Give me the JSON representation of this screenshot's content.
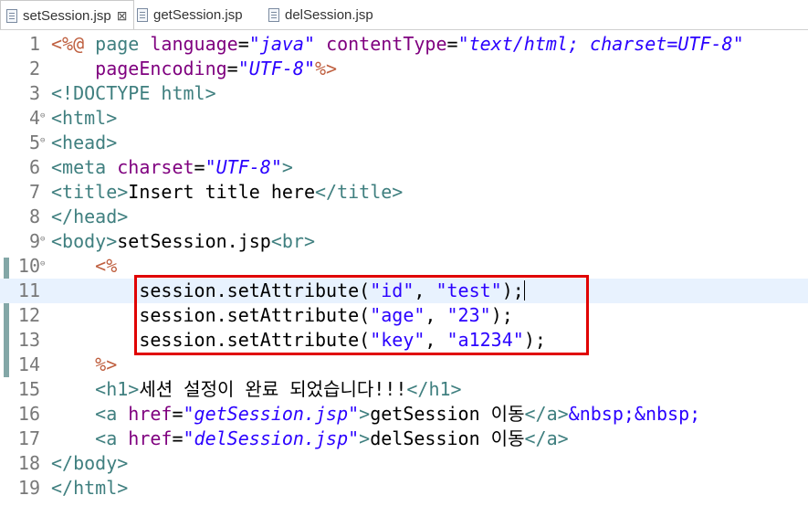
{
  "tabs": [
    {
      "label": "setSession.jsp",
      "close": "⊠",
      "active": true
    },
    {
      "label": "getSession.jsp",
      "active": false
    },
    {
      "label": "delSession.jsp",
      "active": false
    }
  ],
  "lines": [
    {
      "n": "1",
      "tokens": [
        {
          "t": "<%@ ",
          "c": "jsp"
        },
        {
          "t": "page",
          "c": "tag"
        },
        {
          "t": " ",
          "c": "txt"
        },
        {
          "t": "language",
          "c": "attr"
        },
        {
          "t": "=",
          "c": "txt"
        },
        {
          "t": "\"java\"",
          "c": "val"
        },
        {
          "t": " ",
          "c": "txt"
        },
        {
          "t": "contentType",
          "c": "attr"
        },
        {
          "t": "=",
          "c": "txt"
        },
        {
          "t": "\"text/html; charset=UTF-8\"",
          "c": "val"
        }
      ]
    },
    {
      "n": "2",
      "tokens": [
        {
          "t": "    ",
          "c": "txt"
        },
        {
          "t": "pageEncoding",
          "c": "attr"
        },
        {
          "t": "=",
          "c": "txt"
        },
        {
          "t": "\"UTF-8\"",
          "c": "val"
        },
        {
          "t": "%>",
          "c": "jsp"
        }
      ]
    },
    {
      "n": "3",
      "tokens": [
        {
          "t": "<!DOCTYPE html>",
          "c": "tag"
        }
      ]
    },
    {
      "n": "4",
      "fold": true,
      "tokens": [
        {
          "t": "<html>",
          "c": "tag"
        }
      ]
    },
    {
      "n": "5",
      "fold": true,
      "tokens": [
        {
          "t": "<head>",
          "c": "tag"
        }
      ]
    },
    {
      "n": "6",
      "tokens": [
        {
          "t": "<meta ",
          "c": "tag"
        },
        {
          "t": "charset",
          "c": "attr"
        },
        {
          "t": "=",
          "c": "txt"
        },
        {
          "t": "\"UTF-8\"",
          "c": "val"
        },
        {
          "t": ">",
          "c": "tag"
        }
      ]
    },
    {
      "n": "7",
      "tokens": [
        {
          "t": "<title>",
          "c": "tag"
        },
        {
          "t": "Insert title here",
          "c": "txt"
        },
        {
          "t": "</title>",
          "c": "tag"
        }
      ]
    },
    {
      "n": "8",
      "tokens": [
        {
          "t": "</head>",
          "c": "tag"
        }
      ]
    },
    {
      "n": "9",
      "fold": true,
      "tokens": [
        {
          "t": "<body>",
          "c": "tag"
        },
        {
          "t": "setSession.jsp",
          "c": "txt"
        },
        {
          "t": "<br>",
          "c": "tag"
        }
      ]
    },
    {
      "n": "10",
      "fold": true,
      "tokens": [
        {
          "t": "    ",
          "c": "txt"
        },
        {
          "t": "<%",
          "c": "jsp"
        }
      ]
    },
    {
      "n": "11",
      "current": true,
      "caret": true,
      "tokens": [
        {
          "t": "        session.setAttribute(",
          "c": "txt"
        },
        {
          "t": "\"id\"",
          "c": "str"
        },
        {
          "t": ", ",
          "c": "txt"
        },
        {
          "t": "\"test\"",
          "c": "str"
        },
        {
          "t": ");",
          "c": "txt"
        }
      ]
    },
    {
      "n": "12",
      "tokens": [
        {
          "t": "        session.setAttribute(",
          "c": "txt"
        },
        {
          "t": "\"age\"",
          "c": "str"
        },
        {
          "t": ", ",
          "c": "txt"
        },
        {
          "t": "\"23\"",
          "c": "str"
        },
        {
          "t": ");",
          "c": "txt"
        }
      ]
    },
    {
      "n": "13",
      "tokens": [
        {
          "t": "        session.setAttribute(",
          "c": "txt"
        },
        {
          "t": "\"key\"",
          "c": "str"
        },
        {
          "t": ", ",
          "c": "txt"
        },
        {
          "t": "\"a1234\"",
          "c": "str"
        },
        {
          "t": ");",
          "c": "txt"
        }
      ]
    },
    {
      "n": "14",
      "tokens": [
        {
          "t": "    ",
          "c": "txt"
        },
        {
          "t": "%>",
          "c": "jsp"
        }
      ]
    },
    {
      "n": "15",
      "tokens": [
        {
          "t": "    ",
          "c": "txt"
        },
        {
          "t": "<h1>",
          "c": "tag"
        },
        {
          "t": "세션 설정이 완료 되었습니다!!!",
          "c": "txt"
        },
        {
          "t": "</h1>",
          "c": "tag"
        }
      ]
    },
    {
      "n": "16",
      "tokens": [
        {
          "t": "    ",
          "c": "txt"
        },
        {
          "t": "<a ",
          "c": "tag"
        },
        {
          "t": "href",
          "c": "attr"
        },
        {
          "t": "=",
          "c": "txt"
        },
        {
          "t": "\"getSession.jsp\"",
          "c": "val"
        },
        {
          "t": ">",
          "c": "tag"
        },
        {
          "t": "getSession 이동",
          "c": "txt"
        },
        {
          "t": "</a>",
          "c": "tag"
        },
        {
          "t": "&nbsp;&nbsp;",
          "c": "ent"
        }
      ]
    },
    {
      "n": "17",
      "tokens": [
        {
          "t": "    ",
          "c": "txt"
        },
        {
          "t": "<a ",
          "c": "tag"
        },
        {
          "t": "href",
          "c": "attr"
        },
        {
          "t": "=",
          "c": "txt"
        },
        {
          "t": "\"delSession.jsp\"",
          "c": "val"
        },
        {
          "t": ">",
          "c": "tag"
        },
        {
          "t": "delSession 이동",
          "c": "txt"
        },
        {
          "t": "</a>",
          "c": "tag"
        }
      ]
    },
    {
      "n": "18",
      "tokens": [
        {
          "t": "</body>",
          "c": "tag"
        }
      ]
    },
    {
      "n": "19",
      "tokens": [
        {
          "t": "</html>",
          "c": "tag"
        }
      ]
    }
  ],
  "colors": {
    "tag": "#3f7f7f",
    "attr": "#7f007f",
    "value": "#2a00ff",
    "jsp": "#bf5f3f",
    "highlight": "#e00000"
  }
}
